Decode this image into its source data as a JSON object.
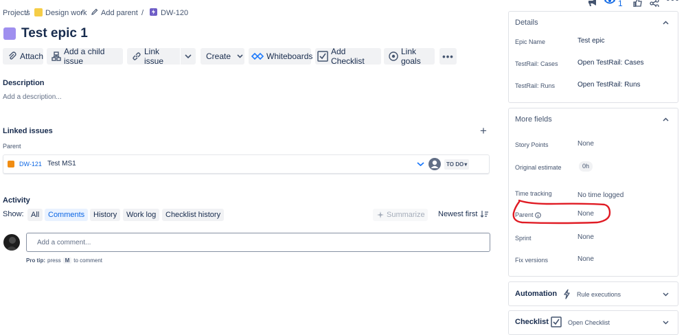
{
  "breadcrumb": {
    "projects": "Projects",
    "sep1": "/",
    "design_work": "Design work",
    "sep2": "/",
    "add_parent": "Add parent",
    "sep3": "/",
    "issue_key": "DW-120"
  },
  "header_actions": {
    "watch_count": "1"
  },
  "issue": {
    "title": "Test epic 1"
  },
  "toolbar": {
    "attach": "Attach",
    "add_child": "Add a child issue",
    "link_issue": "Link issue",
    "create": "Create",
    "whiteboards": "Whiteboards",
    "add_checklist": "Add Checklist",
    "link_goals": "Link goals"
  },
  "description": {
    "heading": "Description",
    "placeholder": "Add a description..."
  },
  "linked_issues": {
    "heading": "Linked issues",
    "parent_label": "Parent",
    "item": {
      "key": "DW-121",
      "summary": "Test MS1",
      "status": "TO DO"
    }
  },
  "activity": {
    "heading": "Activity",
    "show_label": "Show:",
    "tabs": [
      "All",
      "Comments",
      "History",
      "Work log",
      "Checklist history"
    ],
    "summarize": "Summarize",
    "sort": "Newest first",
    "comment_placeholder": "Add a comment...",
    "pro_tip_prefix": "Pro tip:",
    "pro_tip_press": "press",
    "pro_tip_key": "M",
    "pro_tip_suffix": "to comment"
  },
  "details": {
    "heading": "Details",
    "rows": [
      {
        "label": "Epic Name",
        "value_pre": "",
        "value": "Test epic"
      },
      {
        "label": "TestRail: Cases",
        "value_pre": "Open",
        "value": "TestRail: Cases"
      },
      {
        "label": "TestRail: Runs",
        "value_pre": "Open",
        "value": "TestRail: Runs"
      }
    ]
  },
  "more_fields": {
    "heading": "More fields",
    "story_points": {
      "label": "Story Points",
      "value": "None"
    },
    "original_estimate": {
      "label": "Original estimate",
      "value": "0h"
    },
    "time_tracking": {
      "label": "Time tracking",
      "value": "No time logged"
    },
    "parent": {
      "label": "Parent",
      "value": "None"
    },
    "sprint": {
      "label": "Sprint",
      "value": "None"
    },
    "fix_versions": {
      "label": "Fix versions",
      "value": "None"
    }
  },
  "automation": {
    "heading": "Automation",
    "link": "Rule executions"
  },
  "checklist": {
    "heading": "Checklist",
    "link": "Open Checklist"
  },
  "colors": {
    "epic_purple": "#9f8fef",
    "link_blue": "#0c66e4",
    "annotation_red": "#e01b24"
  }
}
